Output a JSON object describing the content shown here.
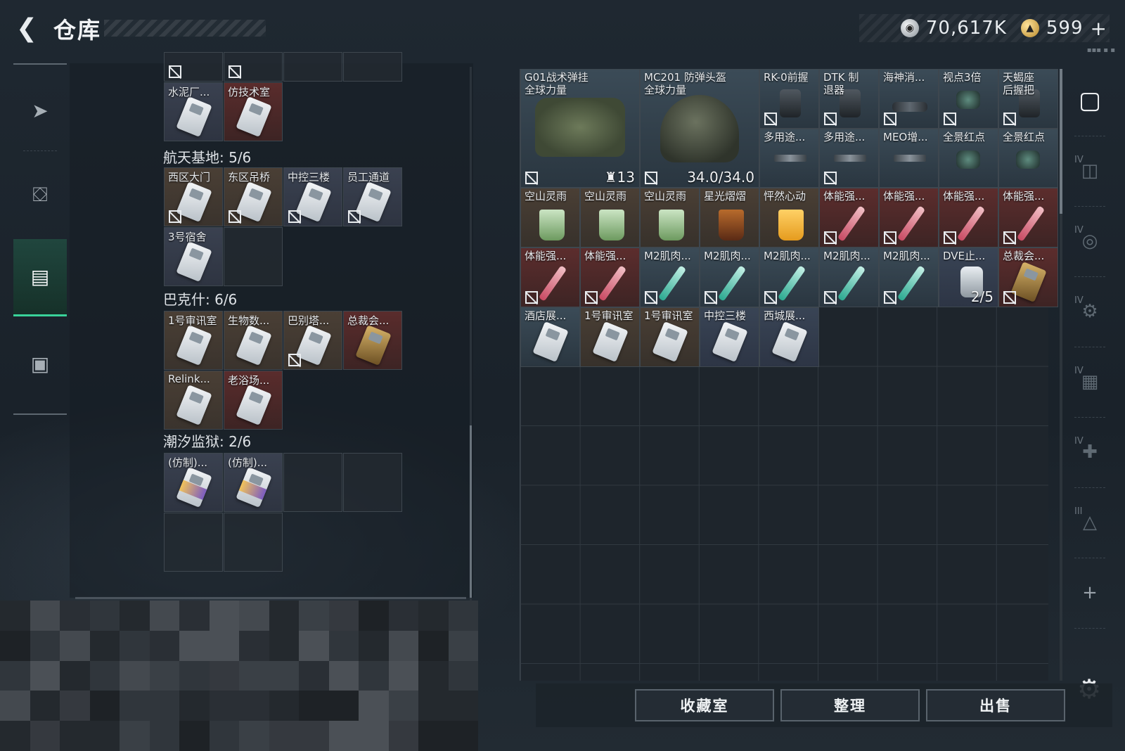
{
  "header": {
    "back_label": "<",
    "title": "仓库",
    "currency_silver": "70,617K",
    "currency_gold": "599",
    "currency_plus": "+"
  },
  "left_nav": {
    "items": [
      {
        "name": "weapons",
        "icon": "gun-icon"
      },
      {
        "name": "armor",
        "icon": "backpack-icon"
      },
      {
        "name": "keycards",
        "icon": "keycard-box-icon"
      },
      {
        "name": "toolbox",
        "icon": "toolbox-icon"
      }
    ],
    "active_index": 2
  },
  "sections": [
    {
      "title": "",
      "cells": [
        {
          "label": "水泥厂...",
          "color": "blue",
          "card": "white",
          "locked": false
        },
        {
          "label": "仿技术室",
          "color": "red",
          "card": "white",
          "locked": false
        }
      ]
    },
    {
      "title": "航天基地: 5/6",
      "cells": [
        {
          "label": "西区大门",
          "color": "brown",
          "card": "white",
          "locked": true
        },
        {
          "label": "东区吊桥",
          "color": "brown",
          "card": "white",
          "locked": true
        },
        {
          "label": "中控三楼",
          "color": "blue",
          "card": "white",
          "locked": true
        },
        {
          "label": "员工通道",
          "color": "blue",
          "card": "white",
          "locked": true
        },
        {
          "label": "3号宿舍",
          "color": "blue",
          "card": "white",
          "locked": false
        }
      ]
    },
    {
      "title": "巴克什: 6/6",
      "cells": [
        {
          "label": "1号审讯室",
          "color": "brown",
          "card": "white",
          "locked": false
        },
        {
          "label": "生物数...",
          "color": "brown",
          "card": "white",
          "locked": false
        },
        {
          "label": "巴别塔...",
          "color": "brown",
          "card": "white",
          "locked": true
        },
        {
          "label": "总裁会...",
          "color": "red",
          "card": "gold",
          "locked": false
        },
        {
          "label": "Relink...",
          "color": "brown",
          "card": "white",
          "locked": false
        },
        {
          "label": "老浴场...",
          "color": "red",
          "card": "white",
          "locked": false
        }
      ]
    },
    {
      "title": "潮汐监狱: 2/6",
      "cells": [
        {
          "label": "(仿制)...",
          "color": "blue",
          "card": "purple",
          "locked": false
        },
        {
          "label": "(仿制)...",
          "color": "blue",
          "card": "purple",
          "locked": false
        }
      ]
    }
  ],
  "stash": {
    "big_items": [
      {
        "label_line1": "G01战术弹挂",
        "label_line2": "全球力量",
        "qty": "13",
        "qty_prefix": "♜"
      },
      {
        "label_line1": "MC201 防弹头盔",
        "label_line2": "全球力量",
        "qty": "34.0/34.0"
      }
    ],
    "row1": [
      "RK-0前握",
      "DTK 制退器",
      "海神消...",
      "视点3倍",
      "天蝎座 后握把"
    ],
    "row2": [
      "多用途...",
      "多用途...",
      "MEO增...",
      "全景红点",
      "全景红点"
    ],
    "row3": [
      "空山灵雨",
      "空山灵雨",
      "空山灵雨",
      "星光熠熠",
      "怦然心动",
      "体能强...",
      "体能强...",
      "体能强...",
      "体能强..."
    ],
    "row4": [
      "体能强...",
      "体能强...",
      "M2肌肉...",
      "M2肌肉...",
      "M2肌肉...",
      "M2肌肉...",
      "M2肌肉...",
      "DVE止...",
      "总裁会..."
    ],
    "row4_dve_qty": "2/5",
    "row5": [
      "酒店展...",
      "1号审讯室",
      "1号审讯室",
      "中控三楼",
      "西城展..."
    ]
  },
  "tools": {
    "items": [
      {
        "icon": "vault-icon",
        "roman": ""
      },
      {
        "icon": "weapon-case-icon",
        "roman": "IV"
      },
      {
        "icon": "camera-case-icon",
        "roman": "IV"
      },
      {
        "icon": "gear-case-icon",
        "roman": "IV"
      },
      {
        "icon": "file-case-icon",
        "roman": "IV"
      },
      {
        "icon": "medkit-case-icon",
        "roman": "IV"
      },
      {
        "icon": "triangle-case-icon",
        "roman": "III"
      },
      {
        "icon": "add-icon",
        "roman": ""
      }
    ]
  },
  "actions": {
    "collection": "收藏室",
    "sort": "整理",
    "sell": "出售"
  },
  "colors": {
    "accent": "#39d39a",
    "cell_brown": "#4a3f35",
    "cell_red": "#5a2c2c",
    "cell_blue": "#3a4150"
  }
}
